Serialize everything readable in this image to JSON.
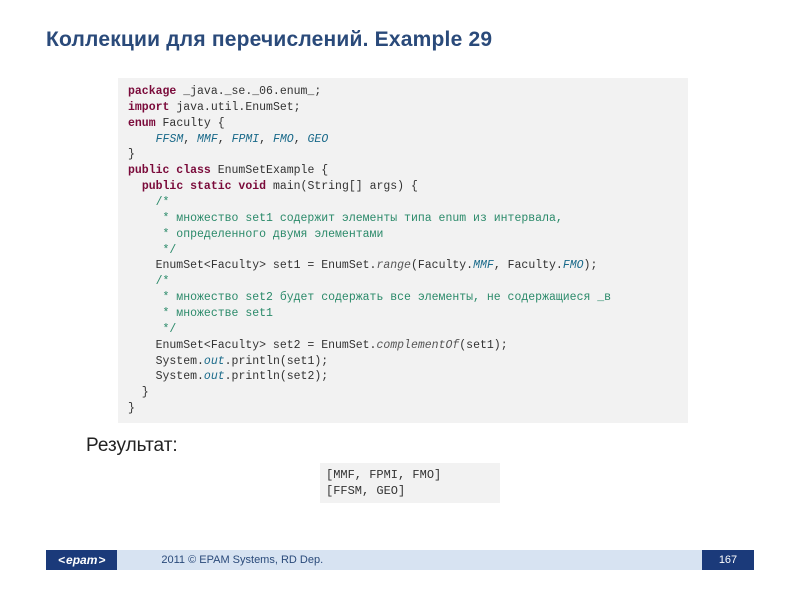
{
  "title": "Коллекции для перечислений. Example 29",
  "code": {
    "l1a": "package",
    "l1b": " _java._se._06.enum_;",
    "l2a": "import",
    "l2b": " java.util.EnumSet;",
    "l3a": "enum",
    "l3b": " Faculty {",
    "l4a": "    ",
    "l4b": "FFSM",
    "l4c": ", ",
    "l4d": "MMF",
    "l4e": ", ",
    "l4f": "FPMI",
    "l4g": ", ",
    "l4h": "FMO",
    "l4i": ", ",
    "l4j": "GEO",
    "l5": "}",
    "l6a": "public class",
    "l6b": " EnumSetExample {",
    "l7a": "  ",
    "l7b": "public static void",
    "l7c": " main(String[] args) {",
    "l8": "    /*",
    "l9": "     * множество set1 содержит элементы типа enum из интервала,",
    "l10": "     * определенного двумя элементами",
    "l11": "     */",
    "l12a": "    EnumSet<Faculty> set1 = EnumSet.",
    "l12b": "range",
    "l12c": "(Faculty.",
    "l12d": "MMF",
    "l12e": ", Faculty.",
    "l12f": "FMO",
    "l12g": ");",
    "l13": "    /*",
    "l14": "     * множество set2 будет содержать все элементы, не содержащиеся _в",
    "l15": "     * множестве set1",
    "l16": "     */",
    "l17a": "    EnumSet<Faculty> set2 = EnumSet.",
    "l17b": "complementOf",
    "l17c": "(set1);",
    "l18a": "    System.",
    "l18b": "out",
    "l18c": ".println(set1);",
    "l19a": "    System.",
    "l19b": "out",
    "l19c": ".println(set2);",
    "l20": "  }",
    "l21": "}"
  },
  "result_label": "Результат:",
  "result": {
    "r1": "[MMF, FPMI, FMO]",
    "r2": "[FFSM, GEO]"
  },
  "footer": {
    "brand_lt": "<",
    "brand": "epam",
    "brand_gt": ">",
    "copyright": "2011 © EPAM Systems, RD Dep.",
    "page": "167"
  }
}
